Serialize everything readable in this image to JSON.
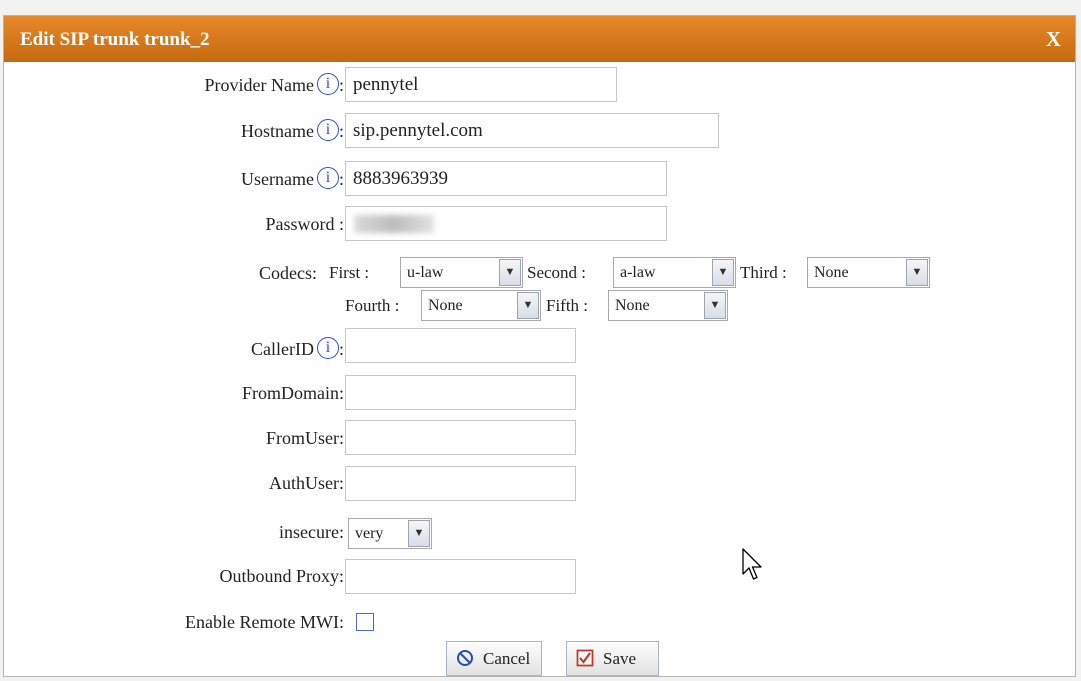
{
  "dialog": {
    "title": "Edit SIP trunk trunk_2",
    "close_label": "X"
  },
  "form": {
    "provider_name": {
      "label": "Provider Name",
      "value": "pennytel"
    },
    "hostname": {
      "label": "Hostname",
      "value": "sip.pennytel.com"
    },
    "username": {
      "label": "Username",
      "value": "8883963939"
    },
    "password": {
      "label": "Password :",
      "value": ""
    },
    "codecs": {
      "label": "Codecs:",
      "first": {
        "label": "First :",
        "value": "u-law"
      },
      "second": {
        "label": "Second :",
        "value": "a-law"
      },
      "third": {
        "label": "Third :",
        "value": "None"
      },
      "fourth": {
        "label": "Fourth :",
        "value": "None"
      },
      "fifth": {
        "label": "Fifth :",
        "value": "None"
      }
    },
    "callerid": {
      "label": "CallerID",
      "value": ""
    },
    "fromdomain": {
      "label": "FromDomain:",
      "value": ""
    },
    "fromuser": {
      "label": "FromUser:",
      "value": ""
    },
    "authuser": {
      "label": "AuthUser:",
      "value": ""
    },
    "insecure": {
      "label": "insecure:",
      "value": "very"
    },
    "outbound_proxy": {
      "label": "Outbound Proxy:",
      "value": ""
    },
    "enable_remote_mwi": {
      "label": "Enable Remote MWI:",
      "checked": false
    }
  },
  "buttons": {
    "cancel": "Cancel",
    "save": "Save"
  },
  "info_glyph": "i",
  "colon": ":",
  "colors": {
    "titlebar": "#d47518",
    "info": "#2a4fd0"
  }
}
